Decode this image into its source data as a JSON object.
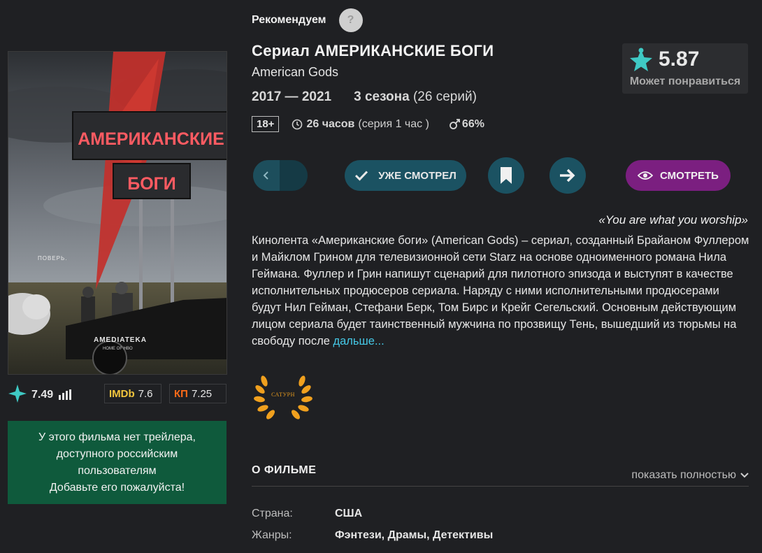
{
  "poster": {
    "sign_line1": "АМЕРИКАНСКИЕ",
    "sign_line2": "БОГИ",
    "tagline": "ПОВЕРЬ.",
    "brand": "AMEDIATEKA",
    "brand_sub": "HOME OF HBO"
  },
  "ratings": {
    "site": "7.49",
    "imdb_label": "IMDb",
    "imdb": "7.6",
    "kp_label": "КП",
    "kp": "7.25"
  },
  "trailer_notice": {
    "line1": "У этого фильма нет трейлера,",
    "line2": "доступного российским",
    "line3": "пользователям",
    "line4": "Добавьте его пожалуйста!"
  },
  "recommend": {
    "label": "Рекомендуем",
    "help": "?"
  },
  "title": "Сериал АМЕРИКАНСКИЕ БОГИ",
  "original_title": "American Gods",
  "years": "2017 — 2021",
  "seasons_count": "3 сезона",
  "episodes": "(26 серий)",
  "age_rating": "18+",
  "duration": {
    "total": "26 часов",
    "per_episode": "(серия 1 час )"
  },
  "male_share": "66%",
  "score": {
    "value": "5.87",
    "caption": "Может понравиться"
  },
  "actions": {
    "watched_label": "УЖЕ СМОТРЕЛ",
    "watch_label": "СМОТРЕТЬ"
  },
  "slogan": "«You are what you worship»",
  "description": "Кинолента «Американские боги» (American Gods) – сериал, созданный Брайаном Фуллером и Майклом Грином для телевизионной сети Starz на основе одноименного романа Нила Геймана. Фуллер и Грин напишут сценарий для пилотного эпизода и выступят в качестве исполнительных продюсеров сериала. Наряду с ними исполнительными продюсерами будут Нил Гейман, Стефани Берк, Том Бирс и Крейг Сегельский. Основным действующим лицом сериала будет таинственный мужчина по прозвищу Тень, вышедший из тюрьмы на свободу после",
  "more_link": "дальше...",
  "award": "САТУРН",
  "about": {
    "heading": "О ФИЛЬМЕ",
    "show_full": "показать полностью",
    "country_label": "Страна:",
    "country": "США",
    "genres_label": "Жанры:",
    "genres": "Фэнтези,  Драмы,  Детективы"
  },
  "colors": {
    "background": "#1f2023",
    "accent_teal": "#1b5262",
    "accent_purple": "#7b1f80",
    "trailer_green": "#0f5a3c",
    "link": "#45c8e6",
    "star": "#3fc9c4"
  }
}
